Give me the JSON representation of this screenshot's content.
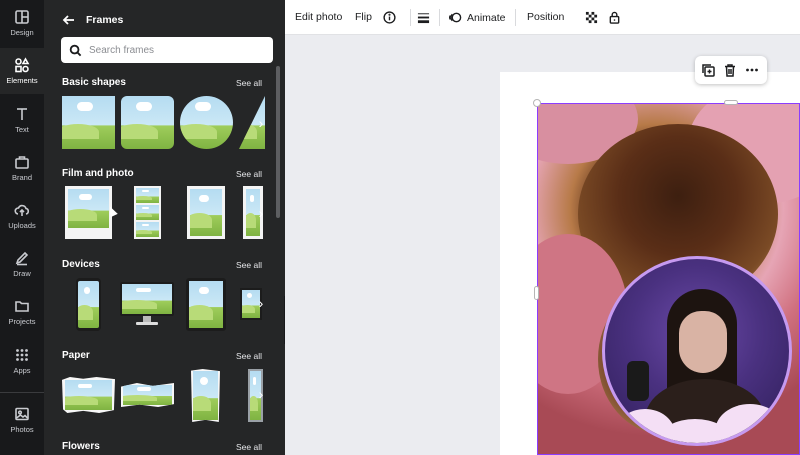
{
  "rail": [
    {
      "label": "Design",
      "icon": "layout-icon"
    },
    {
      "label": "Elements",
      "icon": "shapes-icon",
      "active": true
    },
    {
      "label": "Text",
      "icon": "text-icon"
    },
    {
      "label": "Brand",
      "icon": "brand-icon"
    },
    {
      "label": "Uploads",
      "icon": "cloud-upload-icon"
    },
    {
      "label": "Draw",
      "icon": "pen-icon"
    },
    {
      "label": "Projects",
      "icon": "folder-icon"
    },
    {
      "label": "Apps",
      "icon": "grid-icon"
    },
    {
      "label": "Photos",
      "icon": "image-icon"
    }
  ],
  "panel": {
    "title": "Frames",
    "search_placeholder": "Search frames",
    "sections": [
      {
        "title": "Basic shapes",
        "see_all": "See all"
      },
      {
        "title": "Film and photo",
        "see_all": "See all"
      },
      {
        "title": "Devices",
        "see_all": "See all"
      },
      {
        "title": "Paper",
        "see_all": "See all"
      },
      {
        "title": "Flowers",
        "see_all": "See all"
      }
    ]
  },
  "toolbar": {
    "edit_photo": "Edit photo",
    "flip": "Flip",
    "animate": "Animate",
    "position": "Position"
  },
  "colors": {
    "rail_bg": "#18191b",
    "panel_bg": "#252627",
    "selection": "#8b3dff",
    "canvas_bg": "#ebecf0"
  }
}
